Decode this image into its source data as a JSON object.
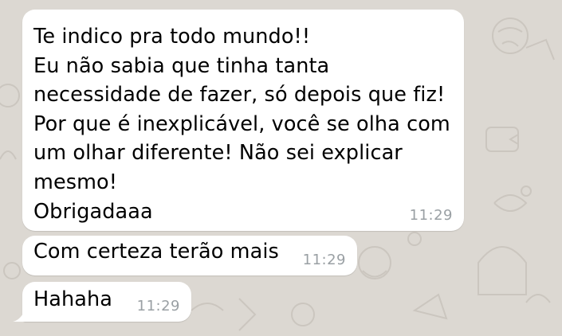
{
  "chat": {
    "wallpaper_color": "#dcd8d2",
    "bubble_color": "#ffffff",
    "messages": [
      {
        "text": "Te indico pra todo mundo!!\nEu não sabia que tinha tanta\nnecessidade de fazer, só depois que fiz!\nPor que é inexplicável, você se olha com\num olhar diferente! Não sei explicar\nmesmo!\nObrigadaaa",
        "time": "11:29"
      },
      {
        "text": "Com certeza terão mais",
        "time": "11:29"
      },
      {
        "text": "Hahaha",
        "time": "11:29"
      }
    ]
  }
}
